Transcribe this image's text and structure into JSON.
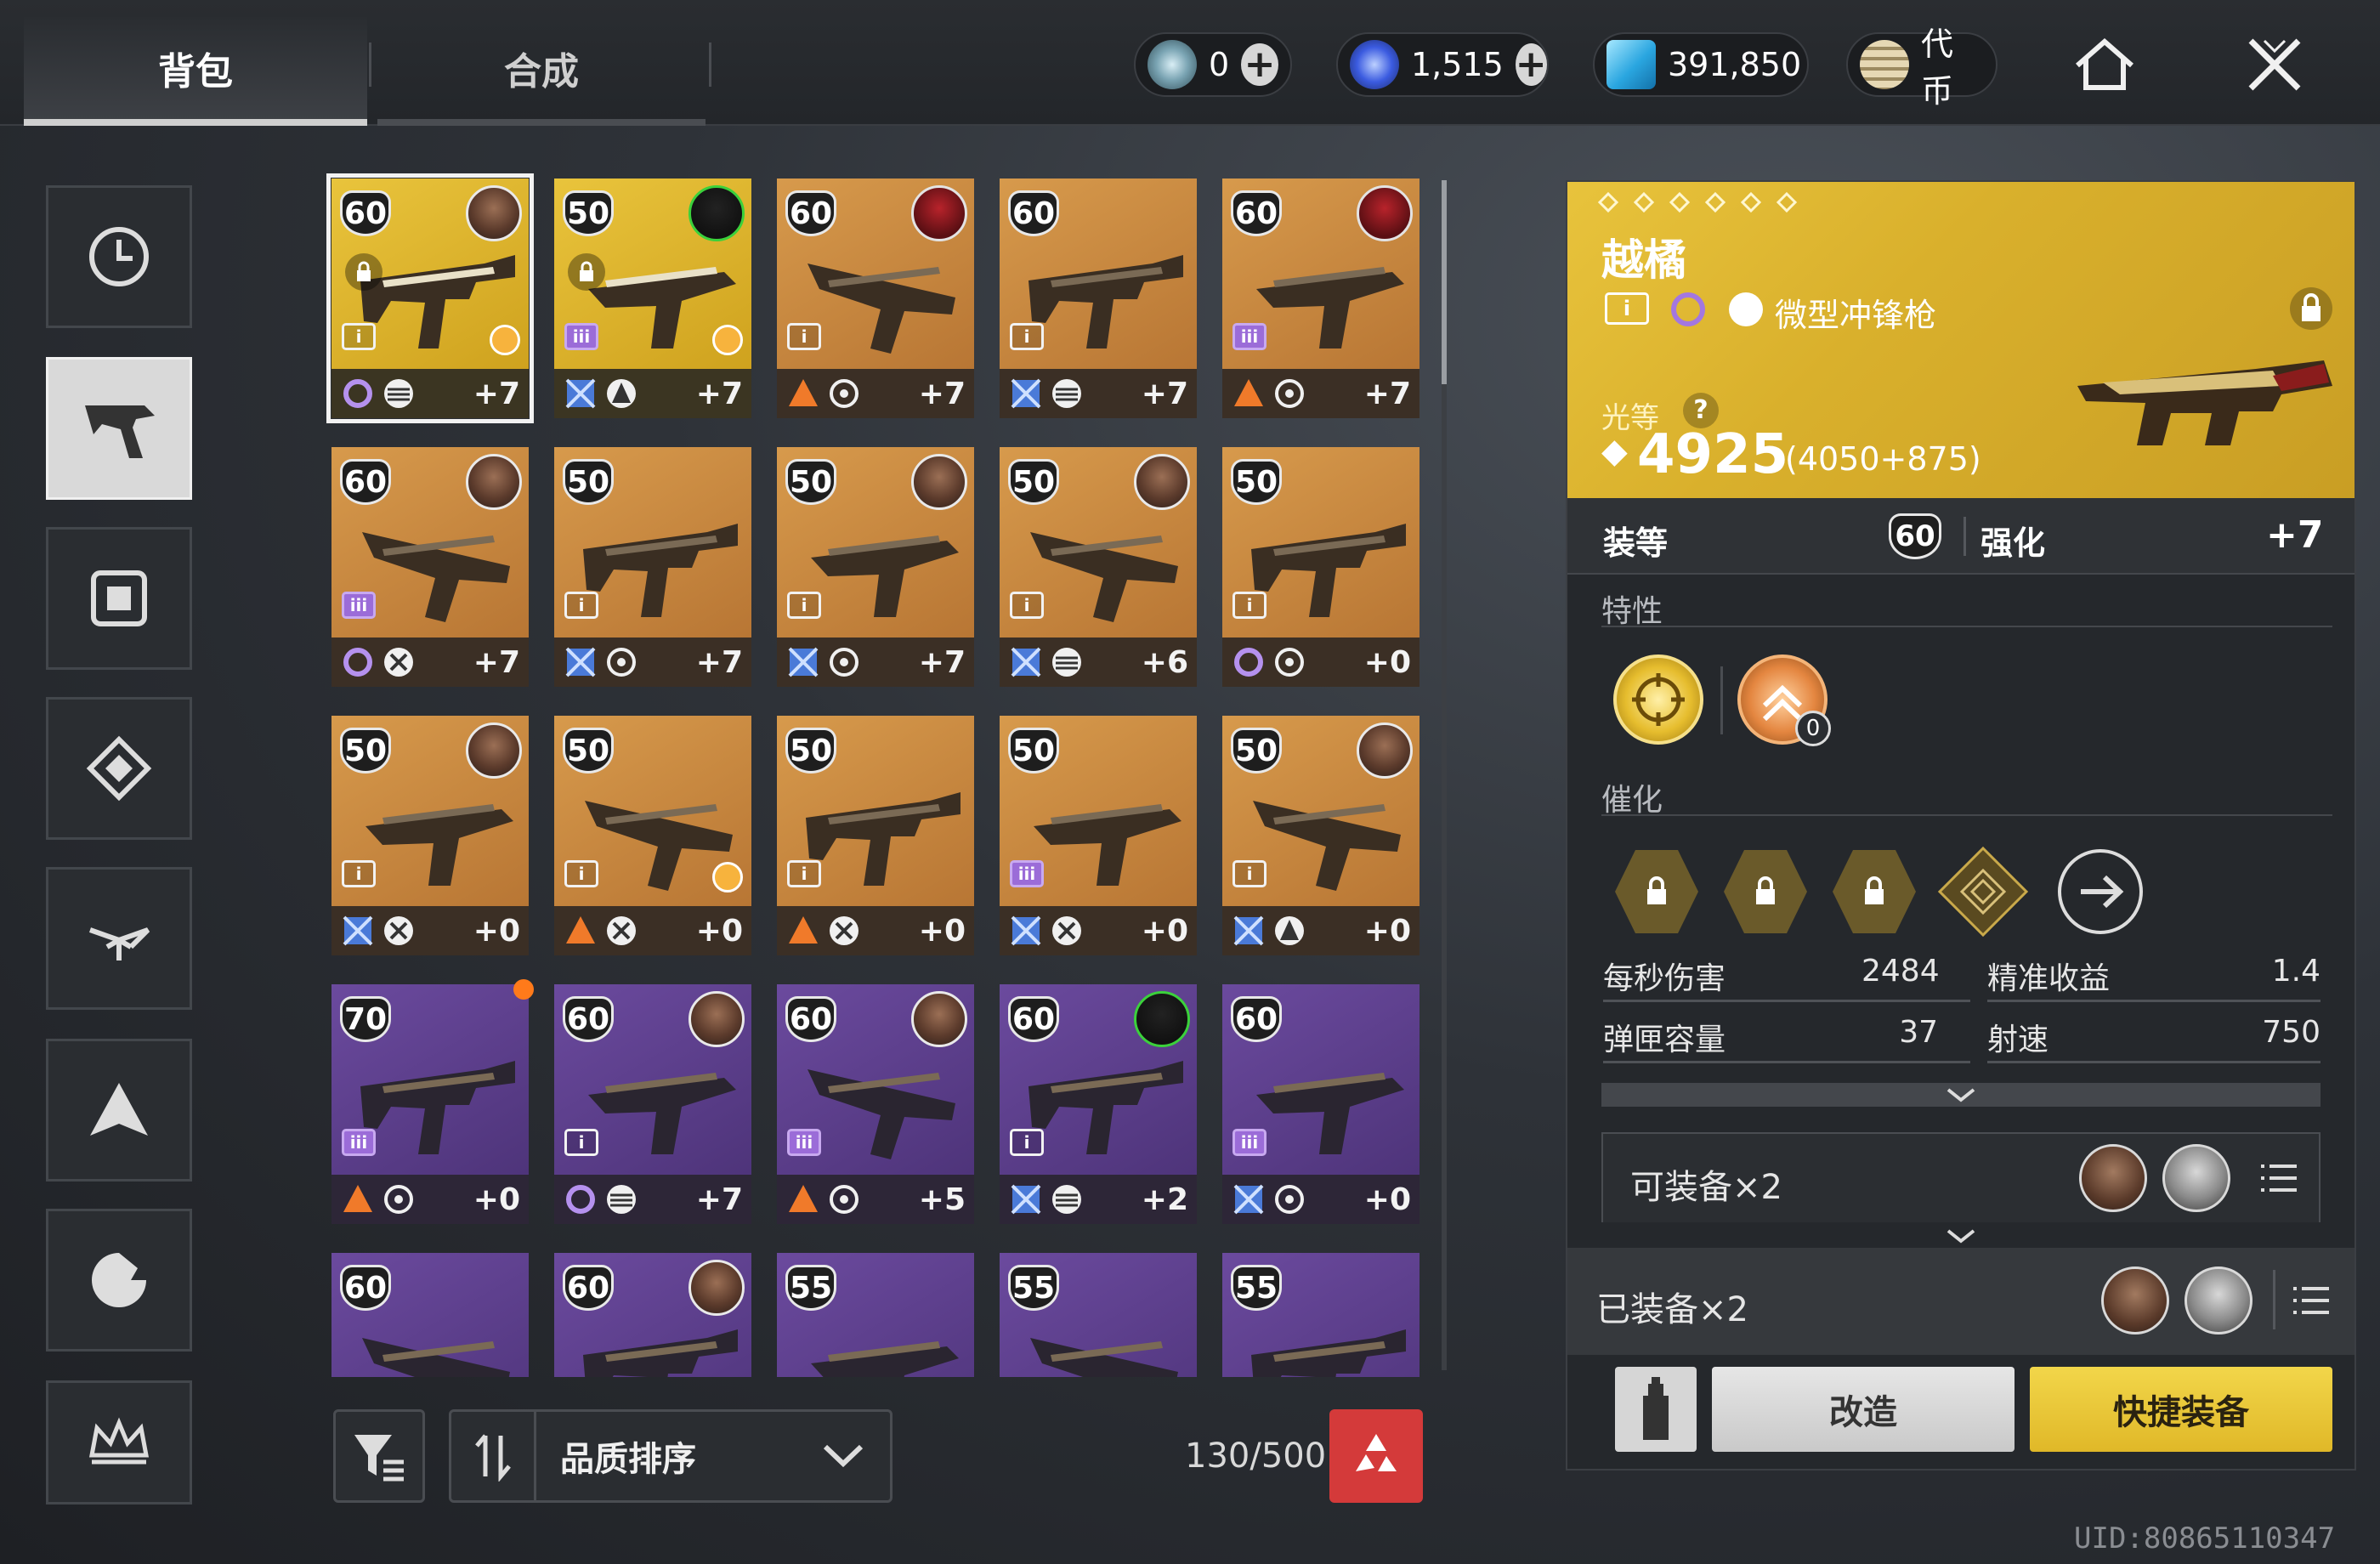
{
  "tabs": {
    "bag": "背包",
    "craft": "合成"
  },
  "currencies": [
    {
      "icon": "silver-orb-icon",
      "value": "0"
    },
    {
      "icon": "blue-crystal-icon",
      "value": "1,515"
    },
    {
      "icon": "glimmer-cube-icon",
      "value": "391,850"
    },
    {
      "icon": "token-coins-icon",
      "value": "代币"
    }
  ],
  "sidebar": [
    "clock-icon",
    "weapon-icon",
    "armor-icon",
    "ghost-icon",
    "emblem-icon",
    "ship-icon",
    "sparrow-icon",
    "crown-icon"
  ],
  "grid": [
    {
      "level": "60",
      "rarity": "yellow",
      "enh": "+7",
      "rank": "i",
      "portrait": "brown",
      "locked": true,
      "sun": true,
      "selected": true,
      "e1": "void",
      "e2": "smg"
    },
    {
      "level": "50",
      "rarity": "yellow",
      "enh": "+7",
      "rank": "iii",
      "portrait": "green",
      "locked": true,
      "sun": true,
      "e1": "strand",
      "e2": "warlock"
    },
    {
      "level": "60",
      "rarity": "orange",
      "enh": "+7",
      "rank": "i",
      "portrait": "red",
      "e1": "solar",
      "e2": "target"
    },
    {
      "level": "60",
      "rarity": "orange",
      "enh": "+7",
      "rank": "i",
      "e1": "strand",
      "e2": "smg"
    },
    {
      "level": "60",
      "rarity": "orange",
      "enh": "+7",
      "rank": "iii",
      "portrait": "red",
      "e1": "solar",
      "e2": "target"
    },
    {
      "level": "60",
      "rarity": "orange",
      "enh": "+7",
      "rank": "iii",
      "portrait": "brown",
      "e1": "void",
      "e2": "cross"
    },
    {
      "level": "50",
      "rarity": "orange",
      "enh": "+7",
      "rank": "i",
      "e1": "strand",
      "e2": "target"
    },
    {
      "level": "50",
      "rarity": "orange",
      "enh": "+7",
      "rank": "i",
      "portrait": "brown",
      "e1": "strand",
      "e2": "target"
    },
    {
      "level": "50",
      "rarity": "orange",
      "enh": "+6",
      "rank": "i",
      "portrait": "silver",
      "e1": "strand",
      "e2": "smg"
    },
    {
      "level": "50",
      "rarity": "orange",
      "enh": "+0",
      "rank": "i",
      "e1": "void",
      "e2": "target"
    },
    {
      "level": "50",
      "rarity": "orange",
      "enh": "+0",
      "rank": "i",
      "portrait": "brown",
      "e1": "strand",
      "e2": "cross"
    },
    {
      "level": "50",
      "rarity": "orange",
      "enh": "+0",
      "rank": "i",
      "sun": true,
      "e1": "solar",
      "e2": "cross"
    },
    {
      "level": "50",
      "rarity": "orange",
      "enh": "+0",
      "rank": "i",
      "e1": "solar",
      "e2": "cross"
    },
    {
      "level": "50",
      "rarity": "orange",
      "enh": "+0",
      "rank": "iii",
      "e1": "strand",
      "e2": "cross"
    },
    {
      "level": "50",
      "rarity": "orange",
      "enh": "+0",
      "rank": "i",
      "portrait": "brown",
      "e1": "strand",
      "e2": "warlock"
    },
    {
      "level": "70",
      "rarity": "purple",
      "enh": "+0",
      "rank": "iii",
      "dot": true,
      "e1": "solar",
      "e2": "target"
    },
    {
      "level": "60",
      "rarity": "purple",
      "enh": "+7",
      "rank": "i",
      "portrait": "brown",
      "e1": "void",
      "e2": "smg"
    },
    {
      "level": "60",
      "rarity": "purple",
      "enh": "+5",
      "rank": "iii",
      "portrait": "brown",
      "e1": "solar",
      "e2": "target"
    },
    {
      "level": "60",
      "rarity": "purple",
      "enh": "+2",
      "rank": "i",
      "portrait": "green",
      "e1": "strand",
      "e2": "smg"
    },
    {
      "level": "60",
      "rarity": "purple",
      "enh": "+0",
      "rank": "iii",
      "e1": "strand",
      "e2": "target"
    },
    {
      "level": "60",
      "rarity": "purple",
      "enh": "",
      "portrait": null
    },
    {
      "level": "60",
      "rarity": "purple",
      "enh": "",
      "portrait": "brown"
    },
    {
      "level": "55",
      "rarity": "purple",
      "enh": ""
    },
    {
      "level": "55",
      "rarity": "purple",
      "enh": ""
    },
    {
      "level": "55",
      "rarity": "purple",
      "enh": ""
    }
  ],
  "controls": {
    "sort_label": "品质排序",
    "capacity": "130/500"
  },
  "detail": {
    "name": "越橘",
    "rank": "i",
    "weapon_type": "微型冲锋枪",
    "power_label": "光等",
    "power_value": "4925",
    "power_breakdown": "(4050+875)",
    "gear_level_label": "装等",
    "gear_level": "60",
    "enhance_label": "强化",
    "enhance_value": "+7",
    "traits_label": "特性",
    "trait_counter": "0",
    "catalyst_label": "催化",
    "stats": [
      {
        "label": "每秒伤害",
        "value": "2484"
      },
      {
        "label": "精准收益",
        "value": "1.4"
      },
      {
        "label": "弹匣容量",
        "value": "37"
      },
      {
        "label": "射速",
        "value": "750"
      }
    ],
    "equipable": "可装备×2",
    "equipped": "已装备×2",
    "modify_label": "改造",
    "quick_equip_label": "快捷装备"
  },
  "uid": "UID:80865110347",
  "colors": {
    "exotic": "#e2bd34",
    "legendary_orange": "#c98a41",
    "rare_purple": "#5c3f8c",
    "recycle": "#d43a3a"
  }
}
